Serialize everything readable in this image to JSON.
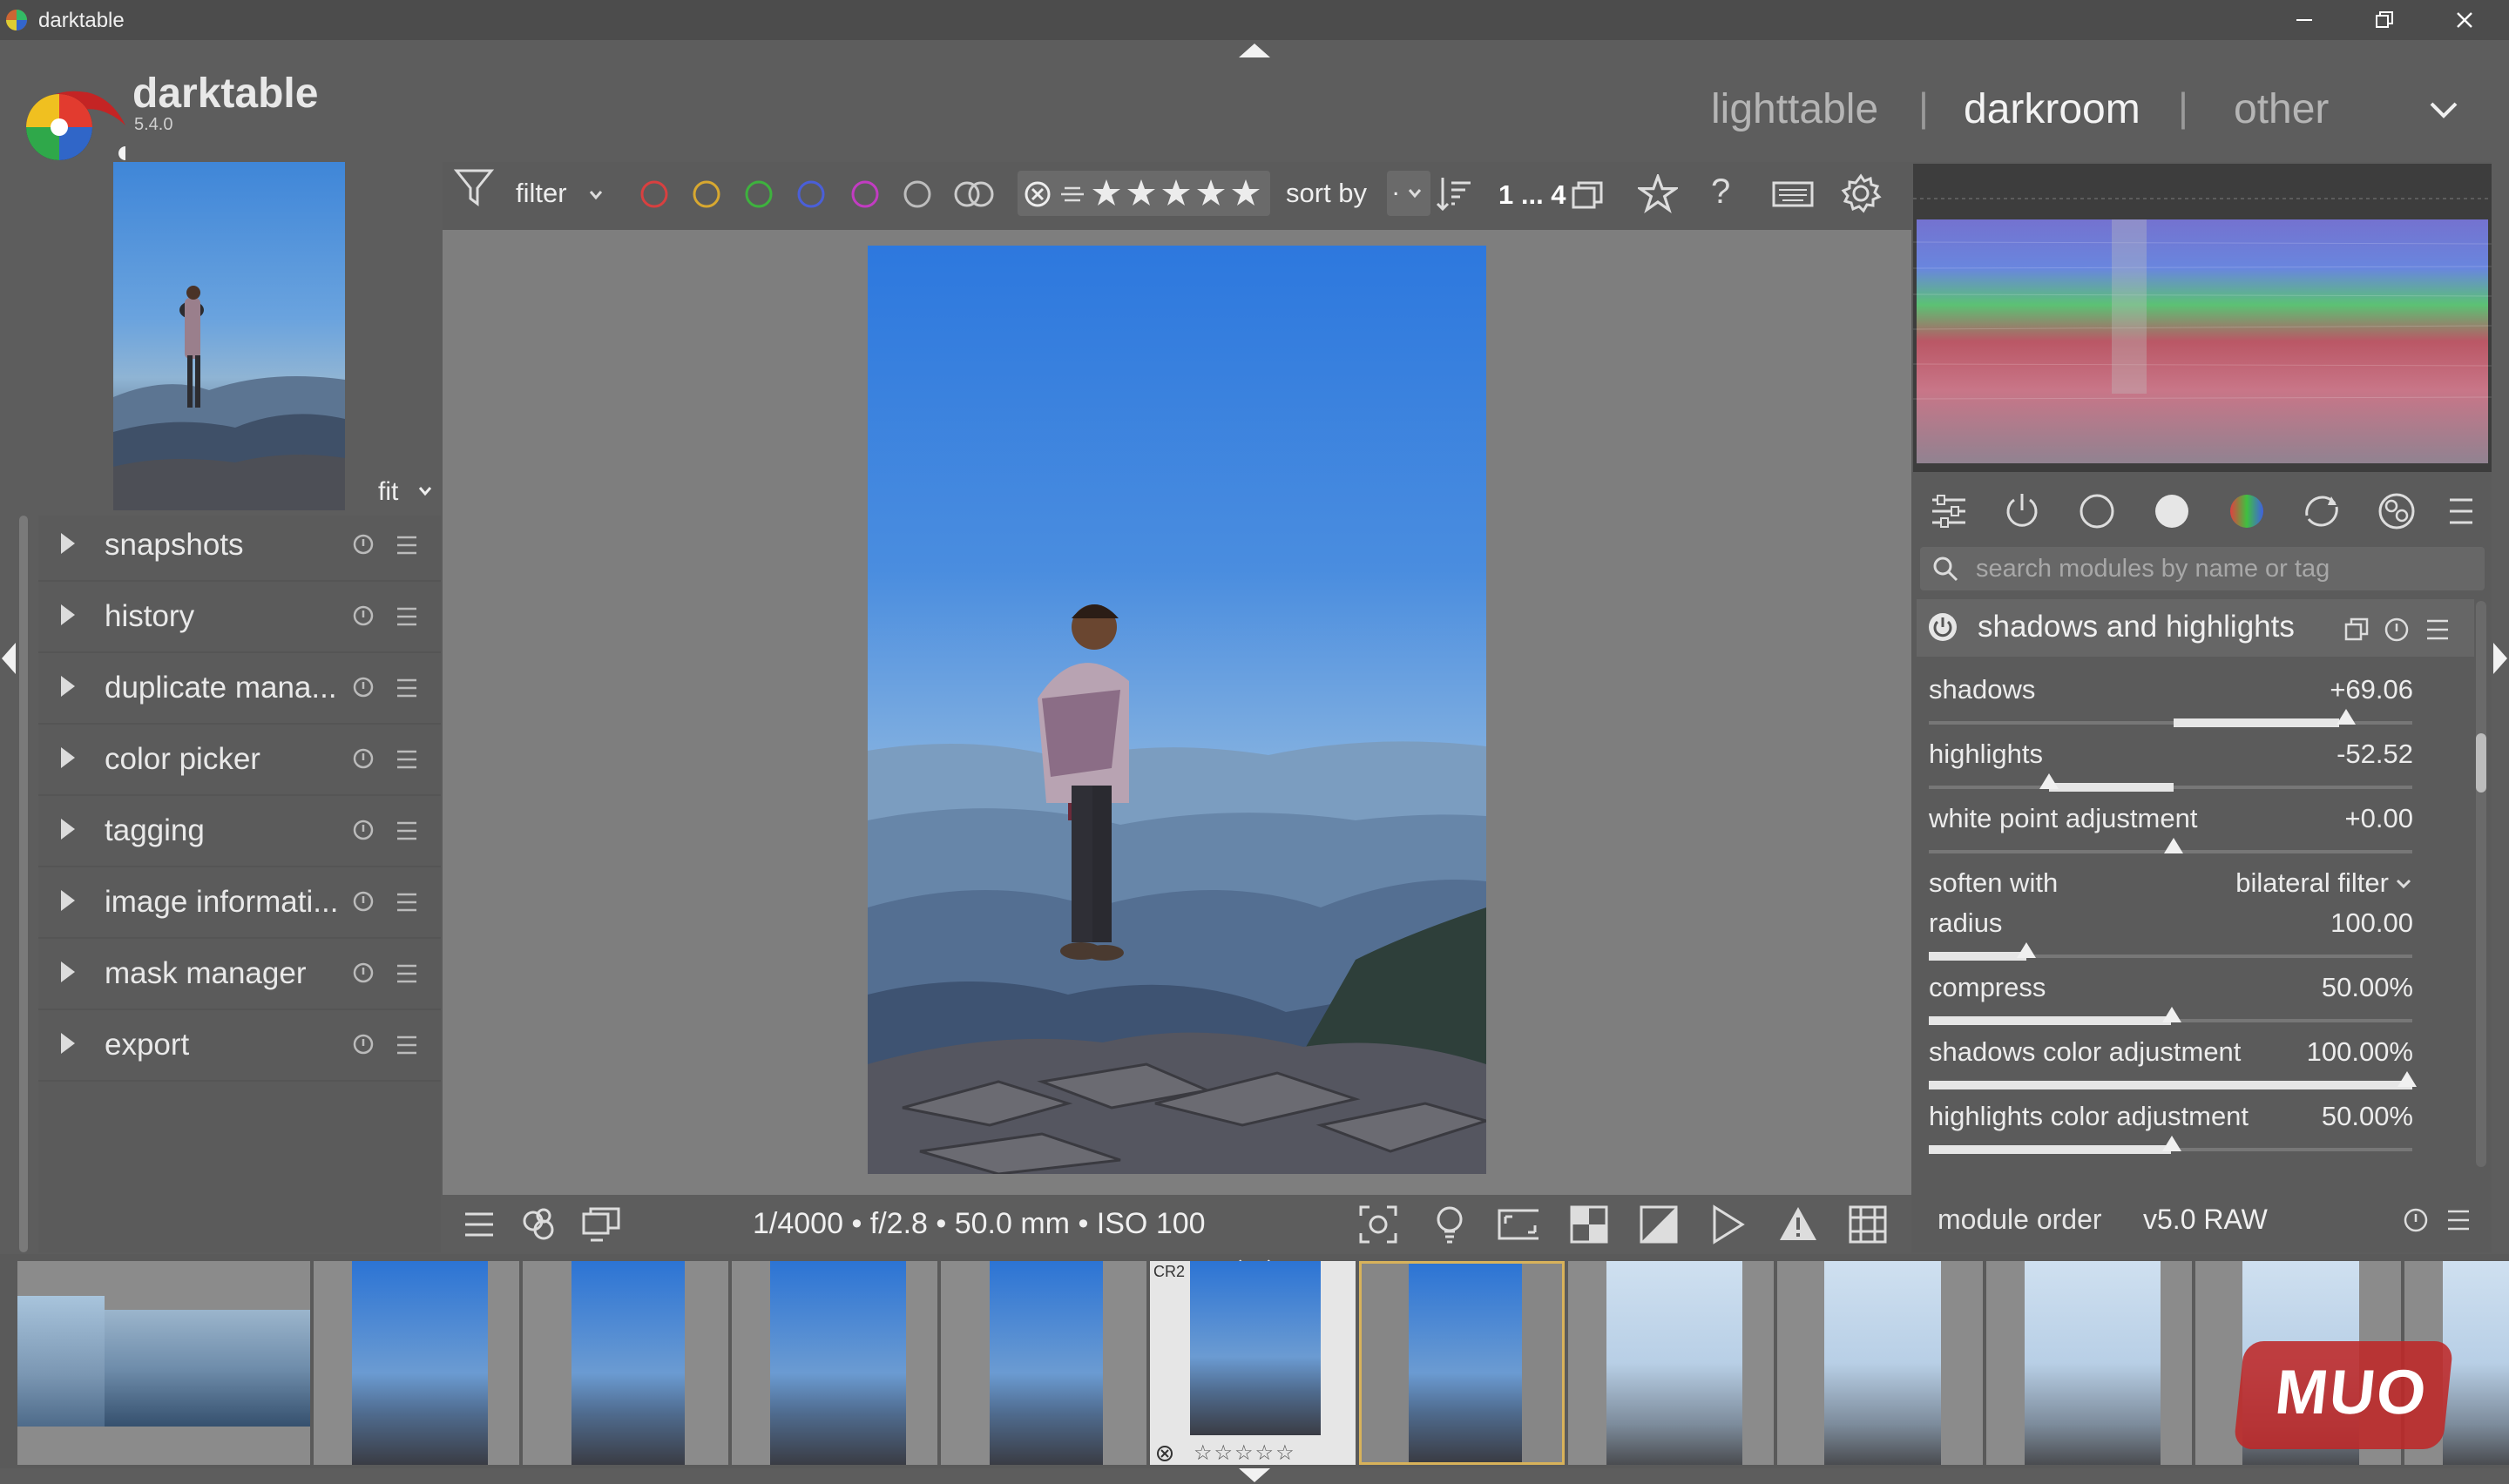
{
  "window": {
    "title": "darktable"
  },
  "app": {
    "name": "darktable",
    "version": "5.4.0"
  },
  "views": {
    "lighttable": "lighttable",
    "darkroom": "darkroom",
    "other": "other",
    "separator": "|"
  },
  "navigation": {
    "zoom": "fit"
  },
  "left_modules": [
    {
      "label": "snapshots"
    },
    {
      "label": "history"
    },
    {
      "label": "duplicate mana..."
    },
    {
      "label": "color picker"
    },
    {
      "label": "tagging"
    },
    {
      "label": "image informati..."
    },
    {
      "label": "mask manager"
    },
    {
      "label": "export"
    }
  ],
  "toolbar": {
    "filter_label": "filter",
    "sort_label": "sort by",
    "sort_value": ".",
    "count": "1 ... 4",
    "color_labels": [
      "#d84040",
      "#d8a830",
      "#3eb23e",
      "#4a5fd8",
      "#c23cc2",
      "#bdbdbd"
    ]
  },
  "module_search": {
    "placeholder": "search modules by name or tag"
  },
  "module": {
    "name": "shadows and highlights",
    "params": [
      {
        "label": "shadows",
        "value": "+69.06",
        "level": 0.845
      },
      {
        "label": "highlights",
        "value": "-52.52",
        "level": 0.237
      },
      {
        "label": "white point adjustment",
        "value": "+0.00",
        "level": 0.5
      },
      {
        "label": "soften with",
        "value": "bilateral filter"
      },
      {
        "label": "radius",
        "value": "100.00",
        "level": 0.2
      },
      {
        "label": "compress",
        "value": "50.00%",
        "level": 0.5
      },
      {
        "label": "shadows color adjustment",
        "value": "100.00%",
        "level": 1.0
      },
      {
        "label": "highlights color adjustment",
        "value": "50.00%",
        "level": 0.5
      }
    ]
  },
  "exif": {
    "text": "1/4000 • f/2.8 • 50.0 mm • ISO 100"
  },
  "module_order": {
    "label": "module order",
    "value": "v5.0 RAW"
  },
  "filmstrip": {
    "selected_badge": "CR2"
  },
  "watermark": {
    "text": "MUO"
  }
}
